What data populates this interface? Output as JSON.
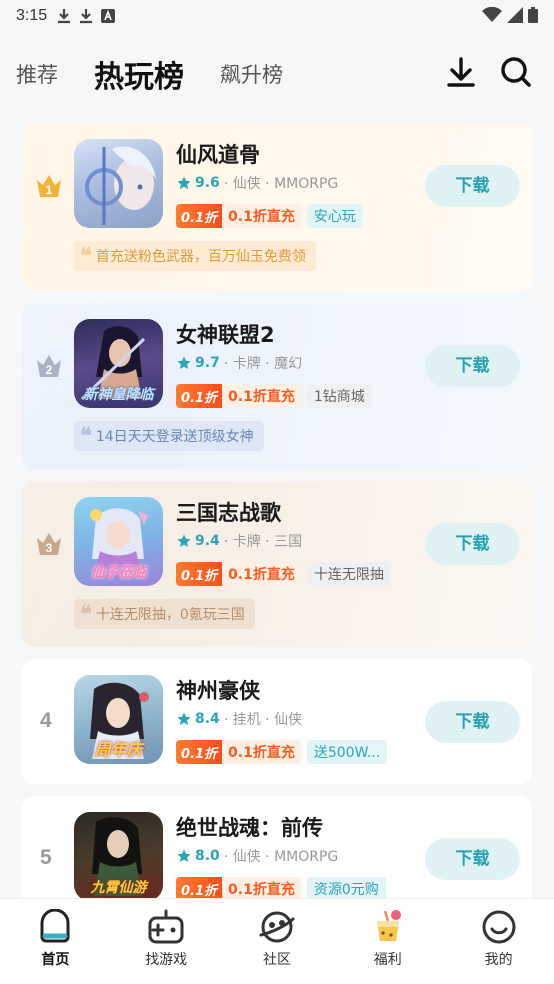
{
  "status_bar": {
    "time": "3:15"
  },
  "top_nav": {
    "tabs": [
      {
        "label": "推荐",
        "active": false
      },
      {
        "label": "热玩榜",
        "active": true
      },
      {
        "label": "飙升榜",
        "active": false
      }
    ],
    "icons": [
      "download-icon",
      "search-icon"
    ]
  },
  "games": [
    {
      "rank": "1",
      "title": "仙风道骨",
      "score": "9.6",
      "genres": "· 仙侠 · MMORPG",
      "discount_badge": "0.1折",
      "discount_text": "0.1折直充",
      "feature_tag": "安心玩",
      "feature_style": "teal",
      "highlight": "首充送粉色武器，百万仙玉免费领",
      "download_label": "下载",
      "theme": "gold",
      "icon_caption": ""
    },
    {
      "rank": "2",
      "title": "女神联盟2",
      "score": "9.7",
      "genres": "· 卡牌 · 魔幻",
      "discount_badge": "0.1折",
      "discount_text": "0.1折直充",
      "feature_tag": "1钻商城",
      "feature_style": "gray",
      "highlight": "14日天天登录送顶级女神",
      "download_label": "下载",
      "theme": "silver",
      "icon_caption": "新神皇降临"
    },
    {
      "rank": "3",
      "title": "三国志战歌",
      "score": "9.4",
      "genres": "· 卡牌 · 三国",
      "discount_badge": "0.1折",
      "discount_text": "0.1折直充",
      "feature_tag": "十连无限抽",
      "feature_style": "gray",
      "highlight": "十连无限抽，0氪玩三国",
      "download_label": "下载",
      "theme": "bronze",
      "icon_caption": "仙子莅临"
    },
    {
      "rank": "4",
      "title": "神州豪侠",
      "score": "8.4",
      "genres": "· 挂机 · 仙侠",
      "discount_badge": "0.1折",
      "discount_text": "0.1折直充",
      "feature_tag": "送500W...",
      "feature_style": "teal",
      "download_label": "下载",
      "theme": "plain",
      "icon_caption": "周年庆"
    },
    {
      "rank": "5",
      "title": "绝世战魂：前传",
      "score": "8.0",
      "genres": "· 仙侠 · MMORPG",
      "discount_badge": "0.1折",
      "discount_text": "0.1折直充",
      "feature_tag": "资源0元购",
      "feature_style": "teal",
      "download_label": "下载",
      "theme": "plain",
      "icon_caption": "九霄仙游"
    }
  ],
  "bottom_nav": [
    {
      "label": "首页",
      "icon": "home-icon",
      "active": true
    },
    {
      "label": "找游戏",
      "icon": "gamepad-icon",
      "active": false
    },
    {
      "label": "社区",
      "icon": "community-icon",
      "active": false
    },
    {
      "label": "福利",
      "icon": "gift-drink-icon",
      "active": false
    },
    {
      "label": "我的",
      "icon": "smile-profile-icon",
      "active": false
    }
  ],
  "colors": {
    "accent_teal": "#26a1b1",
    "discount_orange": "#ff5a1f",
    "gold_bg": "#fff3de",
    "silver_bg": "#e6eefb",
    "bronze_bg": "#f4e9dc"
  }
}
